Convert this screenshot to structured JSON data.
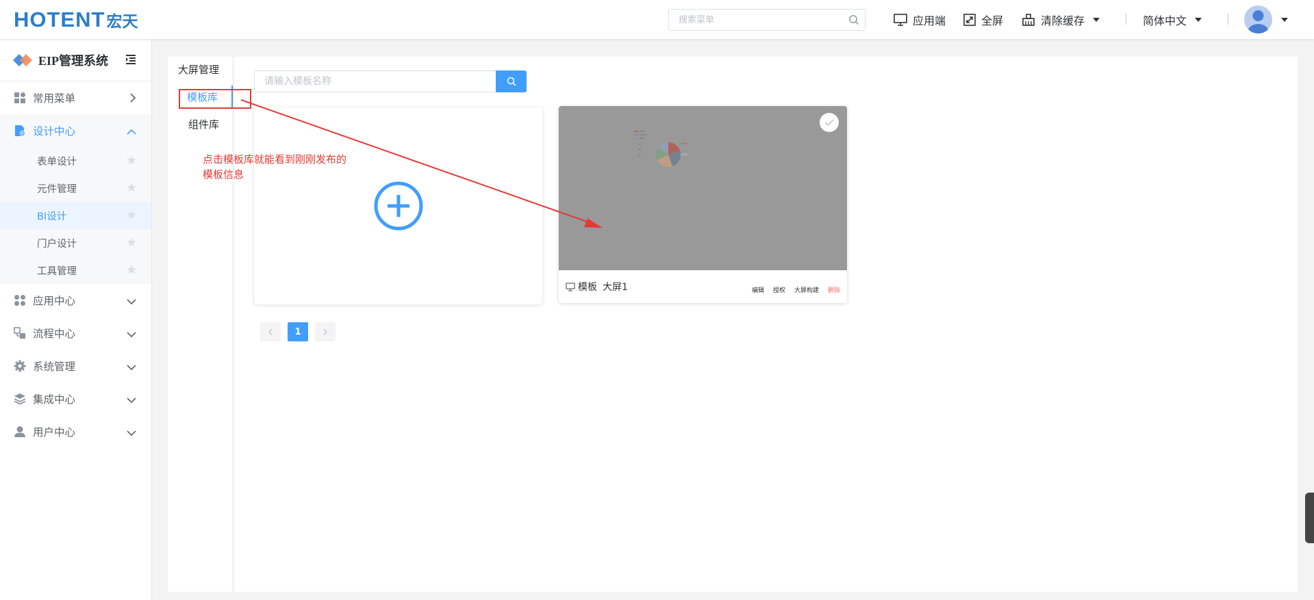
{
  "header": {
    "logo_main": "HOTENT",
    "logo_cn": "宏天",
    "search_placeholder": "搜索菜单",
    "app_label": "应用端",
    "fullscreen_label": "全屏",
    "clear_cache_label": "清除缓存",
    "language_label": "简体中文"
  },
  "sidebar": {
    "title": "EIP管理系统",
    "menus": [
      {
        "label": "常用菜单"
      },
      {
        "label": "设计中心"
      },
      {
        "label": "应用中心"
      },
      {
        "label": "流程中心"
      },
      {
        "label": "系统管理"
      },
      {
        "label": "集成中心"
      },
      {
        "label": "用户中心"
      }
    ],
    "design_submenu": [
      {
        "label": "表单设计"
      },
      {
        "label": "元件管理"
      },
      {
        "label": "BI设计"
      },
      {
        "label": "门户设计"
      },
      {
        "label": "工具管理"
      }
    ]
  },
  "tabs": [
    {
      "label": "大屏管理"
    },
    {
      "label": "模板库"
    },
    {
      "label": "组件库"
    }
  ],
  "annotation": "点击模板库就能看到刚刚发布的模板信息",
  "template_search": {
    "placeholder": "请输入模板名称"
  },
  "template_card": {
    "type_label": "模板",
    "name": "大屏1",
    "actions": [
      "编辑",
      "授权",
      "大屏构建",
      "删除"
    ]
  },
  "pagination": {
    "current_page": "1"
  },
  "colors": {
    "accent": "#409eff",
    "annotation": "#e53935",
    "preview_bg": "#999999"
  }
}
